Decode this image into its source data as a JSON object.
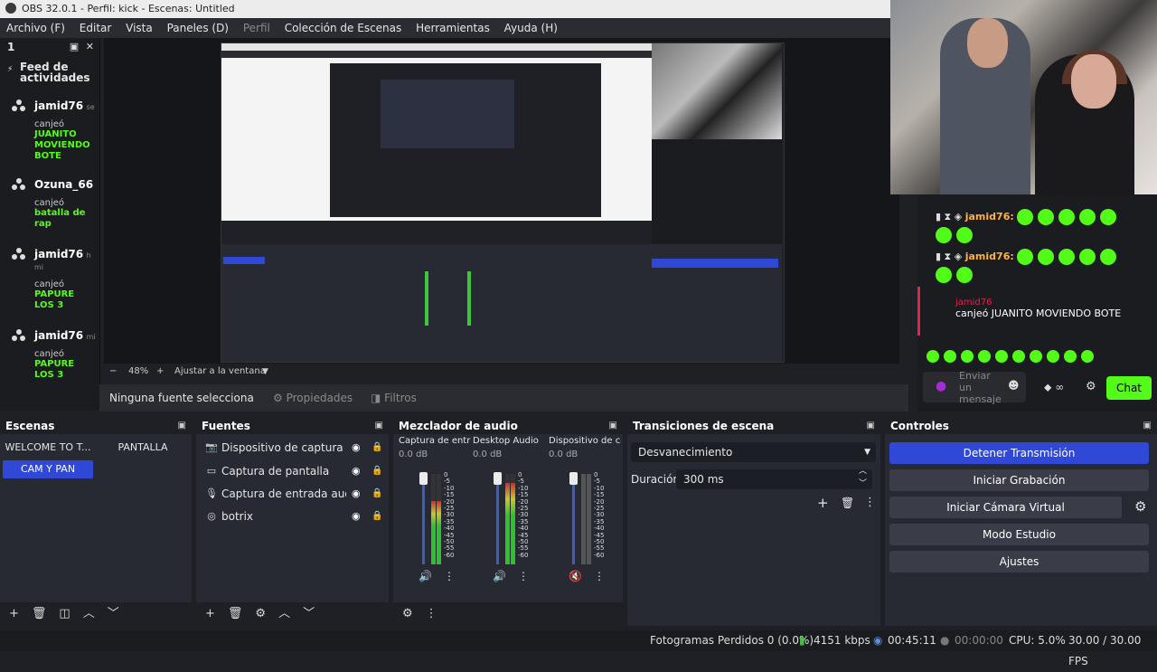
{
  "window": {
    "title": "OBS 32.0.1 - Perfil: kick - Escenas: Untitled"
  },
  "menu": {
    "items": [
      "Archivo (F)",
      "Editar",
      "Vista",
      "Paneles (D)",
      "Perfil",
      "Colección de Escenas",
      "Herramientas",
      "Ayuda (H)"
    ]
  },
  "chat_dock": {
    "title": "1",
    "feed_title_1": "Feed de",
    "feed_title_2": "actividades",
    "items": [
      {
        "name": "jamid76",
        "suffix": "se",
        "action": "canjeó",
        "reward": [
          "JUANITO",
          "MOVIENDO",
          "BOTE"
        ]
      },
      {
        "name": "Ozuna_66",
        "suffix": "",
        "action": "canjeó",
        "reward": [
          "batalla de",
          "rap"
        ]
      },
      {
        "name": "jamid76",
        "suffix": "h mi",
        "action": "canjeó",
        "reward": [
          "PAPURE",
          "LOS 3"
        ]
      },
      {
        "name": "jamid76",
        "suffix": "mi",
        "action": "canjeó",
        "reward": [
          "PAPURE",
          "LOS 3"
        ]
      }
    ]
  },
  "overlay_chat": {
    "line1_name": "jamid76:",
    "line2_name": "jamid76:",
    "redeem_name": "jamid76",
    "redeem_text": "canjeó JUANITO MOVIENDO BOTE",
    "input_placeholder": "Enviar un mensaje",
    "chat_button": "Chat"
  },
  "zoom": {
    "minus": "−",
    "value": "48%",
    "plus": "+",
    "fit": "Ajustar a la ventana"
  },
  "source_bar": {
    "no_source": "Ninguna fuente selecciona",
    "properties": "Propiedades",
    "filters": "Filtros"
  },
  "scenes": {
    "title": "Escenas",
    "items": [
      "WELCOME TO T...",
      "PANTALLA",
      "CAM Y PAN"
    ],
    "active": "CAM Y PAN"
  },
  "sources": {
    "title": "Fuentes",
    "items": [
      {
        "icon": "camera-icon",
        "glyph": "📷",
        "label": "Dispositivo de captura de v"
      },
      {
        "icon": "monitor-icon",
        "glyph": "▭",
        "label": "Captura de pantalla"
      },
      {
        "icon": "mic-icon",
        "glyph": "🎙",
        "label": "Captura de entrada audio"
      },
      {
        "icon": "globe-icon",
        "glyph": "◎",
        "label": "botrix"
      }
    ]
  },
  "mixer": {
    "title": "Mezclador de audio",
    "channels": [
      {
        "name": "Captura de entrada",
        "db": "0.0 dB",
        "level": 0.7,
        "muted": false
      },
      {
        "name": "Desktop Audio",
        "db": "0.0 dB",
        "level": 0.9,
        "muted": false
      },
      {
        "name": "Dispositivo de capt",
        "db": "0.0 dB",
        "level": 0.0,
        "muted": true
      }
    ],
    "scale": [
      "0",
      "-5",
      "-10",
      "-15",
      "-20",
      "-25",
      "-30",
      "-35",
      "-40",
      "-45",
      "-50",
      "-55",
      "-60"
    ]
  },
  "transitions": {
    "title": "Transiciones de escena",
    "selected": "Desvanecimiento",
    "duration_label": "Duración",
    "duration_value": "300 ms"
  },
  "controls": {
    "title": "Controles",
    "stop_stream": "Detener Transmisión",
    "start_record": "Iniciar Grabación",
    "virtual_cam": "Iniciar Cámara Virtual",
    "studio_mode": "Modo Estudio",
    "settings": "Ajustes"
  },
  "status": {
    "dropped": "Fotogramas Perdidos 0 (0.0%)",
    "bitrate": "4151 kbps",
    "stream_time": "00:45:11",
    "record_time": "00:00:00",
    "cpu": "CPU: 5.0%",
    "fps": "30.00 / 30.00 FPS"
  },
  "colors": {
    "accent": "#2f48d6",
    "kick_green": "#53fc18",
    "name_orange": "#ffb23f",
    "scene_active": "#2f48d6"
  }
}
